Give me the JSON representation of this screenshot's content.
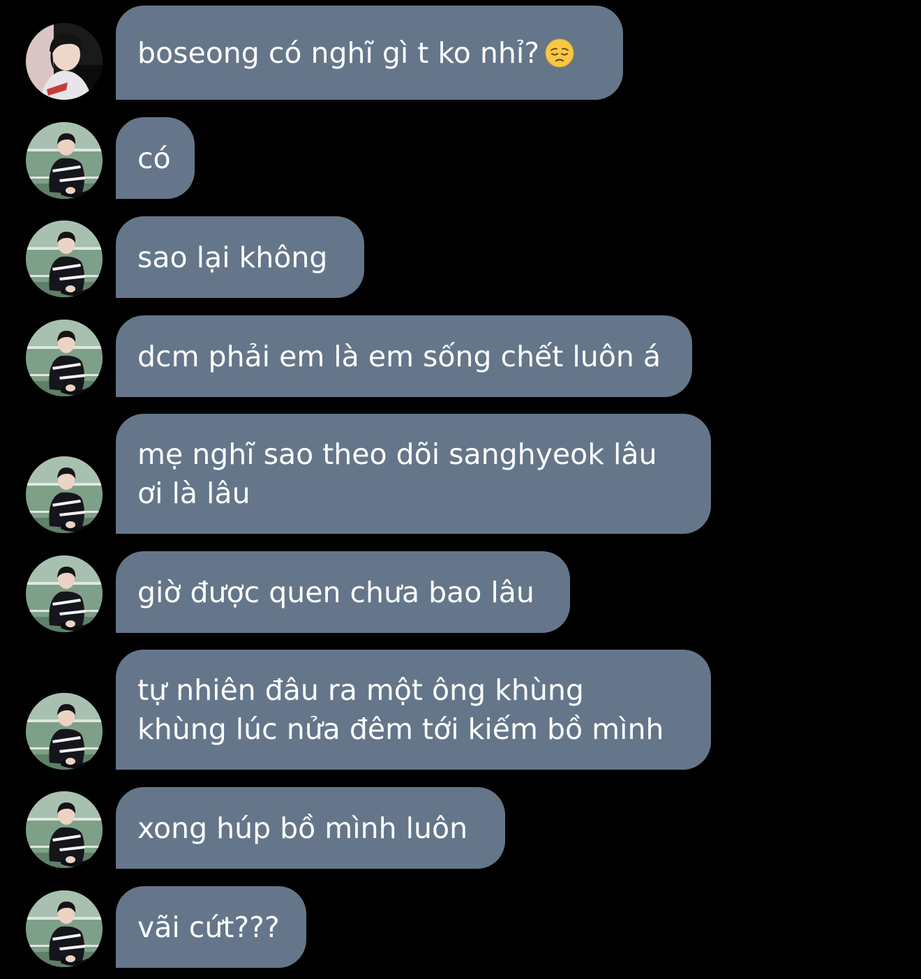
{
  "theme": {
    "background": "#000000",
    "bubble_color": "#65768a",
    "text_color": "#ffffff"
  },
  "messages": [
    {
      "text": "boseong có nghĩ gì t ko nhỉ?",
      "emoji": "pensive-face",
      "avatar": "avatar-other"
    },
    {
      "text": "có",
      "avatar": "avatar-self"
    },
    {
      "text": "sao lại không",
      "avatar": "avatar-self"
    },
    {
      "text": "dcm phải em là em sống chết luôn á",
      "avatar": "avatar-self"
    },
    {
      "text": "mẹ nghĩ sao theo dõi sanghyeok lâu ơi là lâu",
      "avatar": "avatar-self"
    },
    {
      "text": "giờ được quen chưa bao lâu",
      "avatar": "avatar-self"
    },
    {
      "text": "tự nhiên đâu ra một ông khùng khùng lúc nửa đêm tới kiếm bồ mình",
      "avatar": "avatar-self"
    },
    {
      "text": "xong húp bồ mình luôn",
      "avatar": "avatar-self"
    },
    {
      "text": "vãi cứt???",
      "avatar": "avatar-self"
    }
  ]
}
